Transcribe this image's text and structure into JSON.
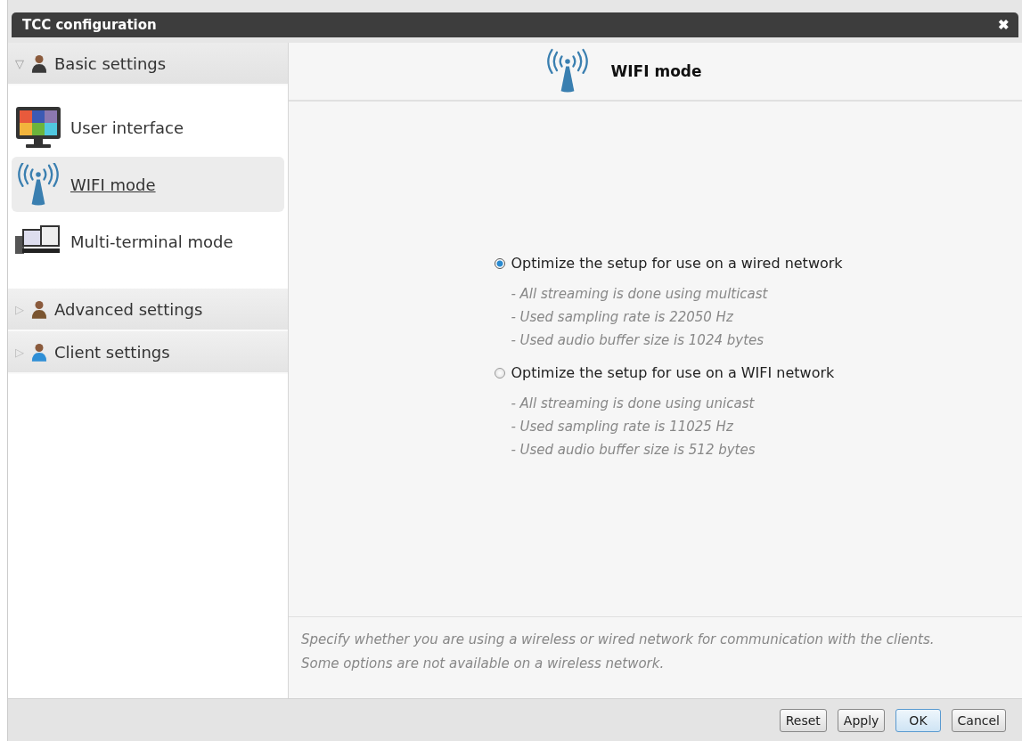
{
  "window": {
    "title": "TCC configuration",
    "close": "✖"
  },
  "sidebar": {
    "groups": [
      {
        "label": "Basic settings",
        "expanded": true,
        "expander": "▽",
        "kind": "manager",
        "items": [
          {
            "label": "User interface",
            "kind": "monitor",
            "selected": false
          },
          {
            "label": "WIFI mode",
            "kind": "wifi",
            "selected": true
          },
          {
            "label": "Multi-terminal mode",
            "kind": "terminals",
            "selected": false
          }
        ]
      },
      {
        "label": "Advanced settings",
        "expanded": false,
        "expander": "▷",
        "kind": "brown"
      },
      {
        "label": "Client settings",
        "expanded": false,
        "expander": "▷",
        "kind": "client"
      }
    ]
  },
  "page": {
    "title": "WIFI mode",
    "options": [
      {
        "label": "Optimize the setup for use on a wired network",
        "selected": true,
        "details": [
          "- All streaming is done using multicast",
          "- Used sampling rate is 22050 Hz",
          "- Used audio buffer size is 1024 bytes"
        ]
      },
      {
        "label": "Optimize the setup for use on a WIFI network",
        "selected": false,
        "details": [
          "- All streaming is done using unicast",
          "- Used sampling rate is 11025 Hz",
          "- Used audio buffer size is 512 bytes"
        ]
      }
    ],
    "description": [
      "Specify whether you are using a wireless or wired network for communication with the clients.",
      "Some options are not available on a wireless network."
    ]
  },
  "buttons": [
    {
      "label": "Reset",
      "default": false
    },
    {
      "label": "Apply",
      "default": false
    },
    {
      "label": "OK",
      "default": true
    },
    {
      "label": "Cancel",
      "default": false
    }
  ]
}
